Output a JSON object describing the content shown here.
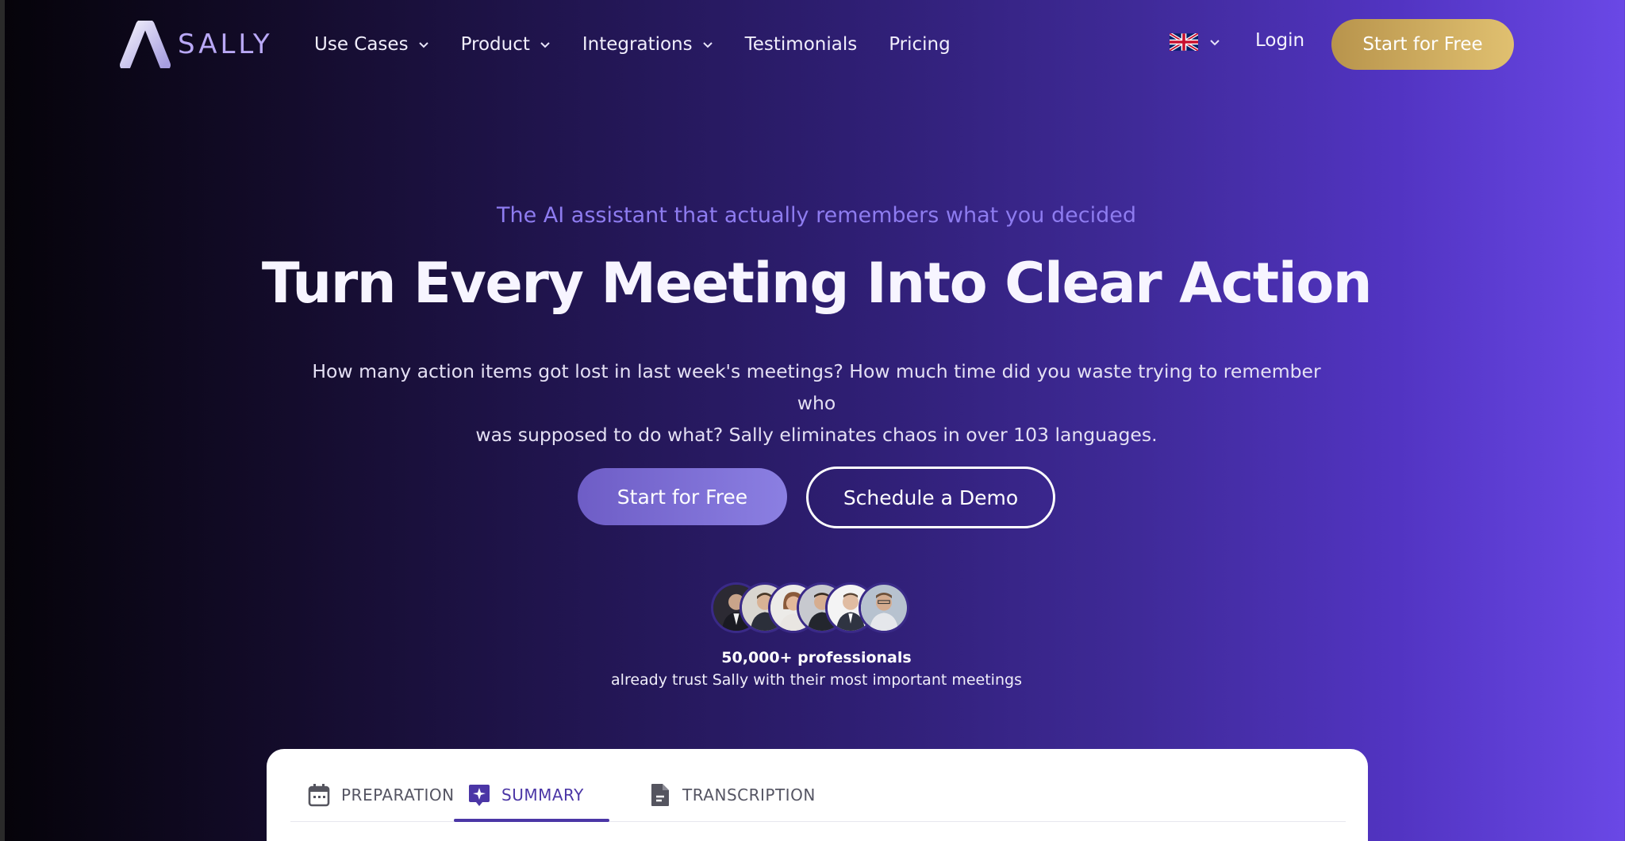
{
  "colors": {
    "accent_gold_start": "#b8944c",
    "accent_gold_end": "#e0c070",
    "primary_purple": "#4b36a6",
    "eyebrow_purple": "#8e7cf0"
  },
  "brand": {
    "name": "SALLY",
    "logo_icon": "sally-a-logo"
  },
  "nav": {
    "items": [
      {
        "label": "Use Cases",
        "has_dropdown": true
      },
      {
        "label": "Product",
        "has_dropdown": true
      },
      {
        "label": "Integrations",
        "has_dropdown": true
      },
      {
        "label": "Testimonials",
        "has_dropdown": false
      },
      {
        "label": "Pricing",
        "has_dropdown": false
      }
    ],
    "language_icon": "uk-flag-icon",
    "login_label": "Login",
    "cta_label": "Start for Free"
  },
  "hero": {
    "eyebrow": "The AI assistant that actually remembers what you decided",
    "headline": "Turn Every Meeting Into Clear Action",
    "subtext_line1": "How many action items got lost in last week's meetings? How much time did you waste trying to remember who",
    "subtext_line2": "was supposed to do what? Sally eliminates chaos in over 103 languages.",
    "primary_cta": "Start for Free",
    "secondary_cta": "Schedule a Demo"
  },
  "social_proof": {
    "title": "50,000+ professionals",
    "subtitle": "already trust Sally with their most important meetings"
  },
  "panel": {
    "tabs": [
      {
        "label": "PREPARATION",
        "icon": "calendar-icon",
        "active": false
      },
      {
        "label": "SUMMARY",
        "icon": "sparkle-icon",
        "active": true
      },
      {
        "label": "TRANSCRIPTION",
        "icon": "document-icon",
        "active": false
      }
    ]
  }
}
